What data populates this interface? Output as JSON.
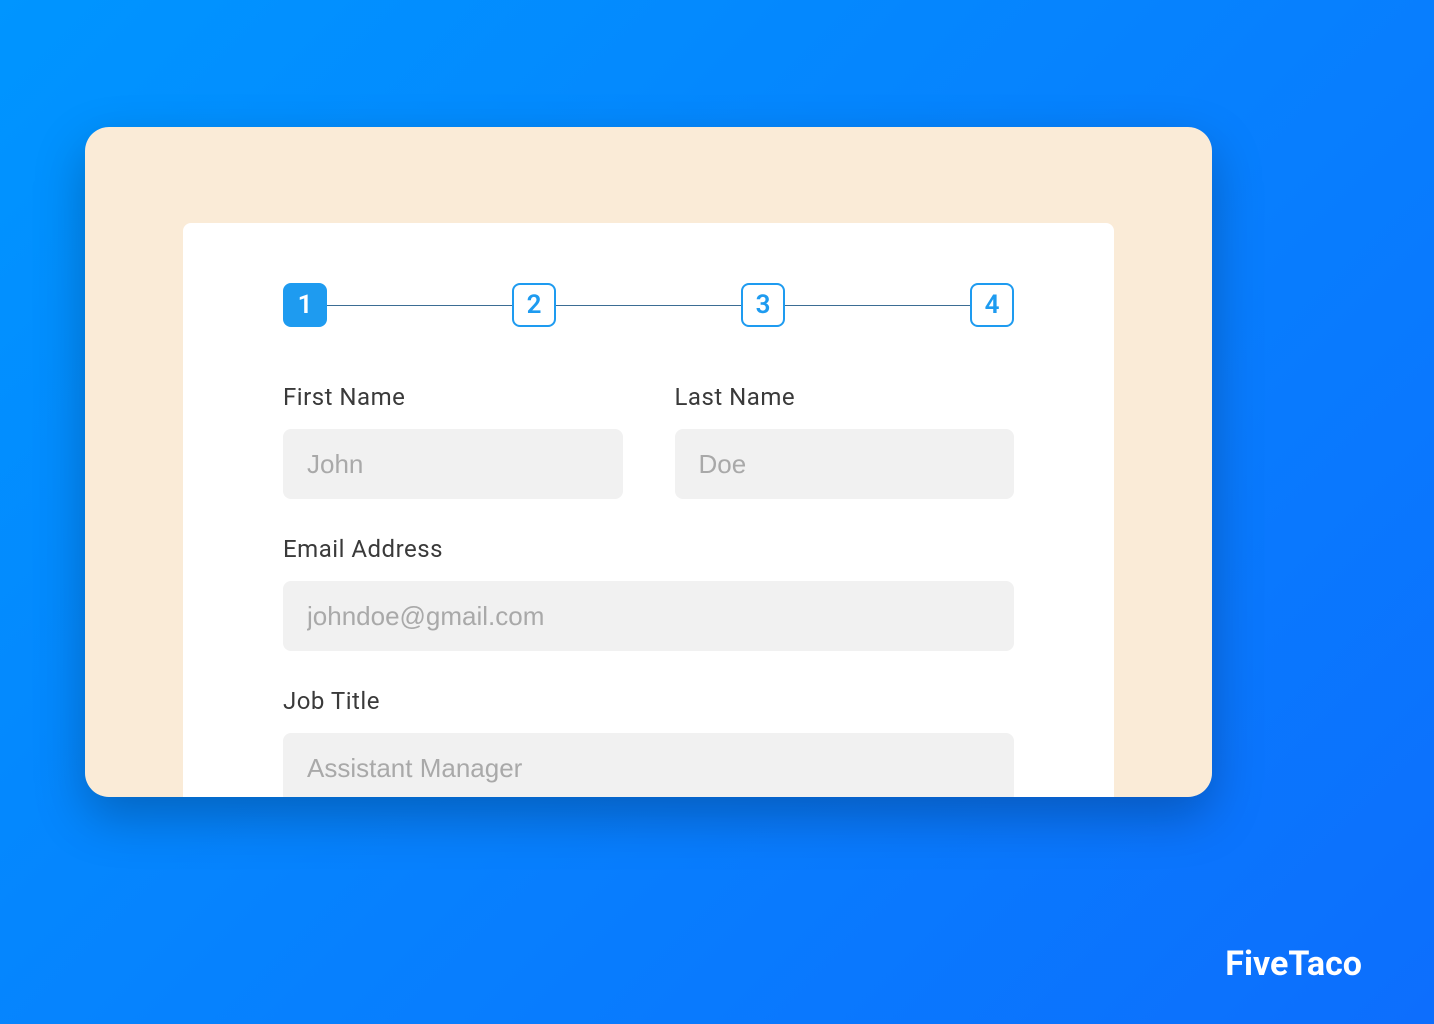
{
  "stepper": {
    "steps": [
      "1",
      "2",
      "3",
      "4"
    ],
    "active_index": 0
  },
  "form": {
    "first_name": {
      "label": "First Name",
      "placeholder": "John",
      "value": ""
    },
    "last_name": {
      "label": "Last Name",
      "placeholder": "Doe",
      "value": ""
    },
    "email": {
      "label": "Email Address",
      "placeholder": "johndoe@gmail.com",
      "value": ""
    },
    "job_title": {
      "label": "Job Title",
      "placeholder": "Assistant Manager",
      "value": ""
    }
  },
  "brand": "FiveTaco",
  "colors": {
    "accent": "#1e9bf0",
    "background_gradient_start": "#0095ff",
    "background_gradient_end": "#0d6efd",
    "outer_card": "#faebd7",
    "input_bg": "#f1f1f1"
  }
}
